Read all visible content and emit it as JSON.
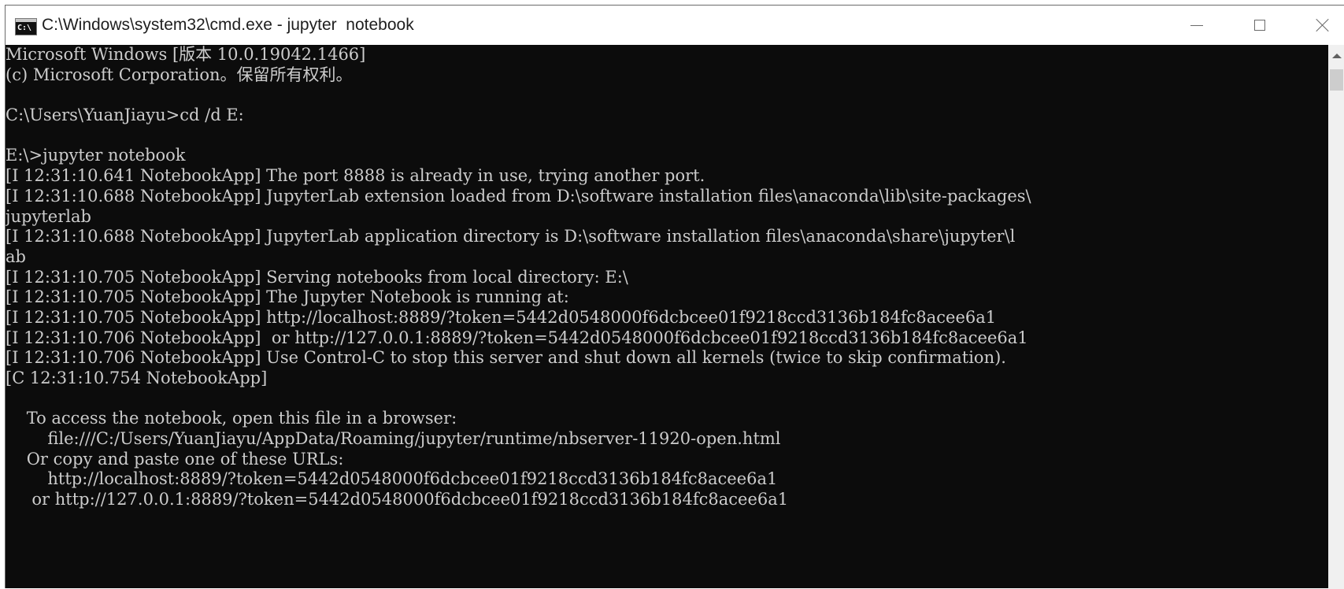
{
  "window": {
    "title": "C:\\Windows\\system32\\cmd.exe - jupyter  notebook",
    "icon_text": "C:\\",
    "icon": "cmd-icon",
    "controls": {
      "minimize": "minimize-icon",
      "maximize": "maximize-icon",
      "close": "close-icon"
    }
  },
  "colors": {
    "console_bg": "#0c0c0c",
    "console_fg": "#cccccc",
    "titlebar_bg": "#ffffff"
  },
  "console": {
    "lines": [
      "Microsoft Windows [版本 10.0.19042.1466]",
      "(c) Microsoft Corporation。保留所有权利。",
      "",
      "C:\\Users\\YuanJiayu>cd /d E:",
      "",
      "E:\\>jupyter notebook",
      "[I 12:31:10.641 NotebookApp] The port 8888 is already in use, trying another port.",
      "[I 12:31:10.688 NotebookApp] JupyterLab extension loaded from D:\\software installation files\\anaconda\\lib\\site-packages\\",
      "jupyterlab",
      "[I 12:31:10.688 NotebookApp] JupyterLab application directory is D:\\software installation files\\anaconda\\share\\jupyter\\l",
      "ab",
      "[I 12:31:10.705 NotebookApp] Serving notebooks from local directory: E:\\",
      "[I 12:31:10.705 NotebookApp] The Jupyter Notebook is running at:",
      "[I 12:31:10.705 NotebookApp] http://localhost:8889/?token=5442d0548000f6dcbcee01f9218ccd3136b184fc8acee6a1",
      "[I 12:31:10.706 NotebookApp]  or http://127.0.0.1:8889/?token=5442d0548000f6dcbcee01f9218ccd3136b184fc8acee6a1",
      "[I 12:31:10.706 NotebookApp] Use Control-C to stop this server and shut down all kernels (twice to skip confirmation).",
      "[C 12:31:10.754 NotebookApp]",
      "",
      "    To access the notebook, open this file in a browser:",
      "        file:///C:/Users/YuanJiayu/AppData/Roaming/jupyter/runtime/nbserver-11920-open.html",
      "    Or copy and paste one of these URLs:",
      "        http://localhost:8889/?token=5442d0548000f6dcbcee01f9218ccd3136b184fc8acee6a1",
      "     or http://127.0.0.1:8889/?token=5442d0548000f6dcbcee01f9218ccd3136b184fc8acee6a1"
    ]
  },
  "scrollbar": {
    "up_arrow": "scroll-up-arrow-icon"
  }
}
